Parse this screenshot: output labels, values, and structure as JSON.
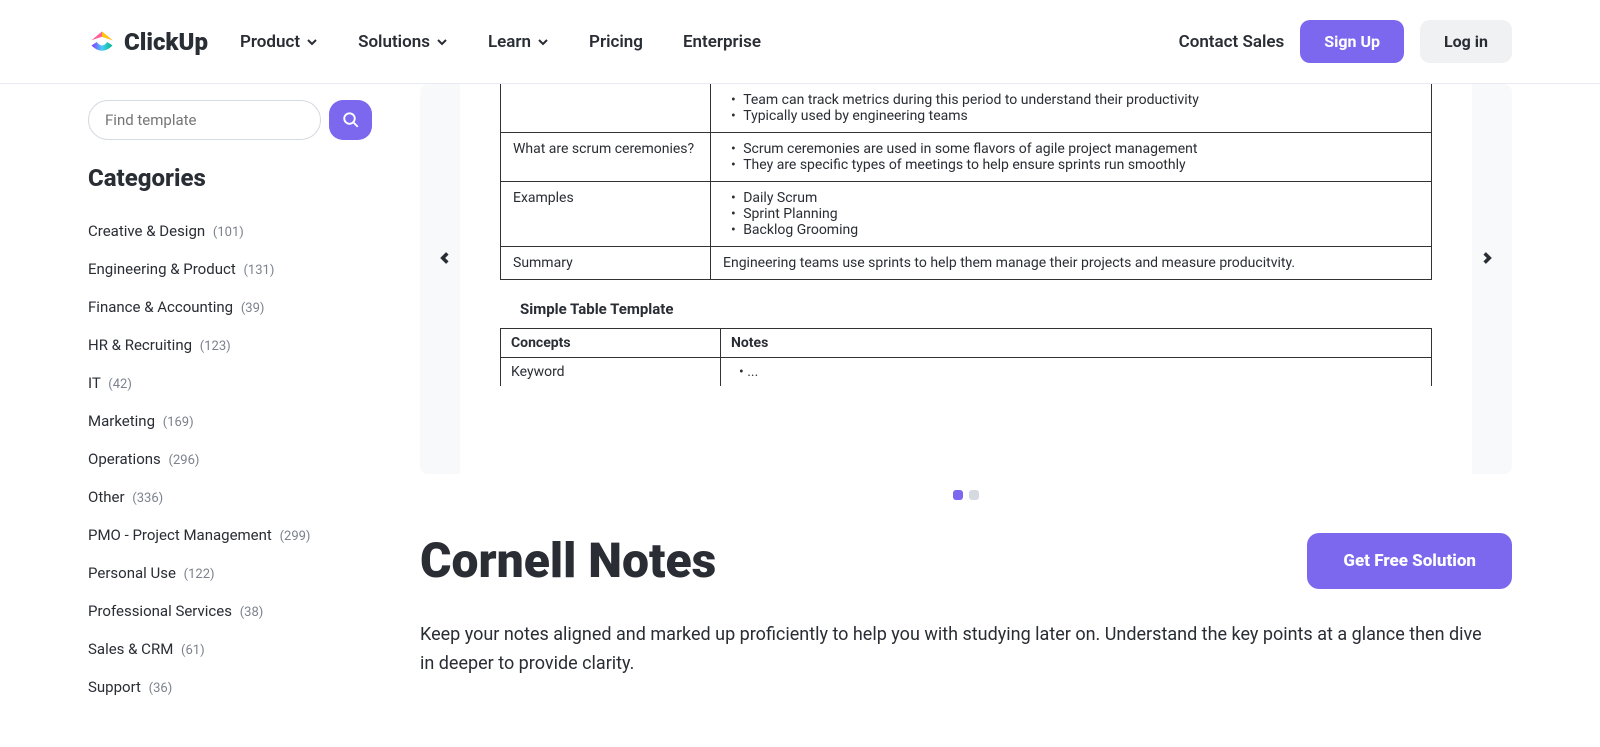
{
  "header": {
    "logo_text": "ClickUp",
    "nav": [
      "Product",
      "Solutions",
      "Learn",
      "Pricing",
      "Enterprise"
    ],
    "contact": "Contact Sales",
    "signup": "Sign Up",
    "login": "Log in"
  },
  "sidebar": {
    "search_placeholder": "Find template",
    "categories_title": "Categories",
    "categories": [
      {
        "name": "Creative & Design",
        "count": "(101)"
      },
      {
        "name": "Engineering & Product",
        "count": "(131)"
      },
      {
        "name": "Finance & Accounting",
        "count": "(39)"
      },
      {
        "name": "HR & Recruiting",
        "count": "(123)"
      },
      {
        "name": "IT",
        "count": "(42)"
      },
      {
        "name": "Marketing",
        "count": "(169)"
      },
      {
        "name": "Operations",
        "count": "(296)"
      },
      {
        "name": "Other",
        "count": "(336)"
      },
      {
        "name": "PMO - Project Management",
        "count": "(299)"
      },
      {
        "name": "Personal Use",
        "count": "(122)"
      },
      {
        "name": "Professional Services",
        "count": "(38)"
      },
      {
        "name": "Sales & CRM",
        "count": "(61)"
      },
      {
        "name": "Support",
        "count": "(36)"
      }
    ]
  },
  "preview": {
    "row1_bullet1": "Team can track metrics during this period to understand their productivity",
    "row1_bullet2": "Typically used by engineering teams",
    "row2_label": "What are scrum ceremonies?",
    "row2_bullet1": "Scrum ceremonies are used in some flavors of agile project management",
    "row2_bullet2": "They are specific types of meetings to help ensure sprints run smoothly",
    "row3_label": "Examples",
    "row3_bullet1": "Daily Scrum",
    "row3_bullet2": "Sprint Planning",
    "row3_bullet3": "Backlog Grooming",
    "row4_label": "Summary",
    "row4_text": "Engineering teams use sprints to help them manage their projects and measure producitvity.",
    "sub_title": "Simple Table Template",
    "t2_h1": "Concepts",
    "t2_h2": "Notes",
    "t2_r1c1": "Keyword",
    "t2_r1c2": "..."
  },
  "page": {
    "title": "Cornell Notes",
    "cta": "Get Free Solution",
    "description": "Keep your notes aligned and marked up proficiently to help you with studying later on. Understand the key points at a glance then dive in deeper to provide clarity."
  }
}
